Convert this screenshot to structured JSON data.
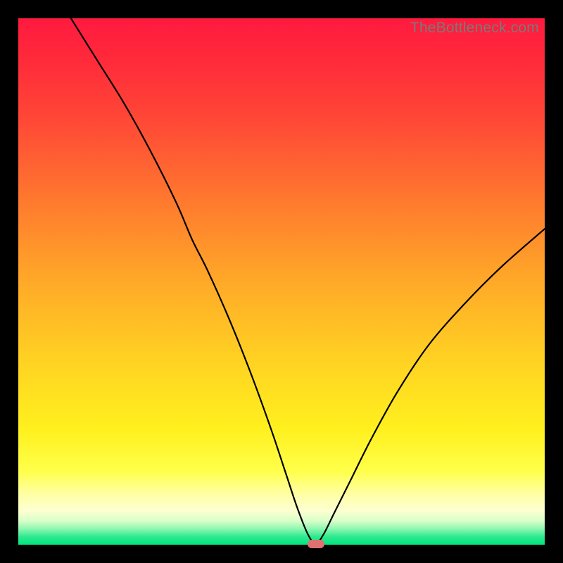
{
  "watermark": "TheBottleneck.com",
  "colors": {
    "frame": "#000000",
    "curve": "#000000",
    "marker": "#e17070"
  },
  "chart_data": {
    "type": "line",
    "title": "",
    "xlabel": "",
    "ylabel": "",
    "xlim": [
      0,
      100
    ],
    "ylim": [
      0,
      100
    ],
    "annotations": [
      {
        "kind": "marker",
        "shape": "pill",
        "x": 56.5,
        "y": 0.2,
        "color": "#e17070"
      }
    ],
    "series": [
      {
        "name": "bottleneck-curve",
        "x": [
          10,
          15,
          20,
          25,
          30,
          33,
          36,
          40,
          44,
          48,
          51,
          53,
          55,
          56.5,
          58,
          60,
          63,
          67,
          72,
          78,
          85,
          92,
          100
        ],
        "y": [
          100,
          92,
          84,
          75,
          65,
          58,
          52,
          43,
          33,
          22,
          13,
          7,
          2,
          0.2,
          2,
          6,
          12,
          20,
          29,
          38,
          46,
          53,
          60
        ]
      }
    ],
    "background_gradient": {
      "type": "vertical",
      "stops": [
        {
          "pos": 0.0,
          "color": "#ff1a3f"
        },
        {
          "pos": 0.5,
          "color": "#ffa928"
        },
        {
          "pos": 0.86,
          "color": "#ffff4a"
        },
        {
          "pos": 1.0,
          "color": "#00e77f"
        }
      ]
    }
  }
}
